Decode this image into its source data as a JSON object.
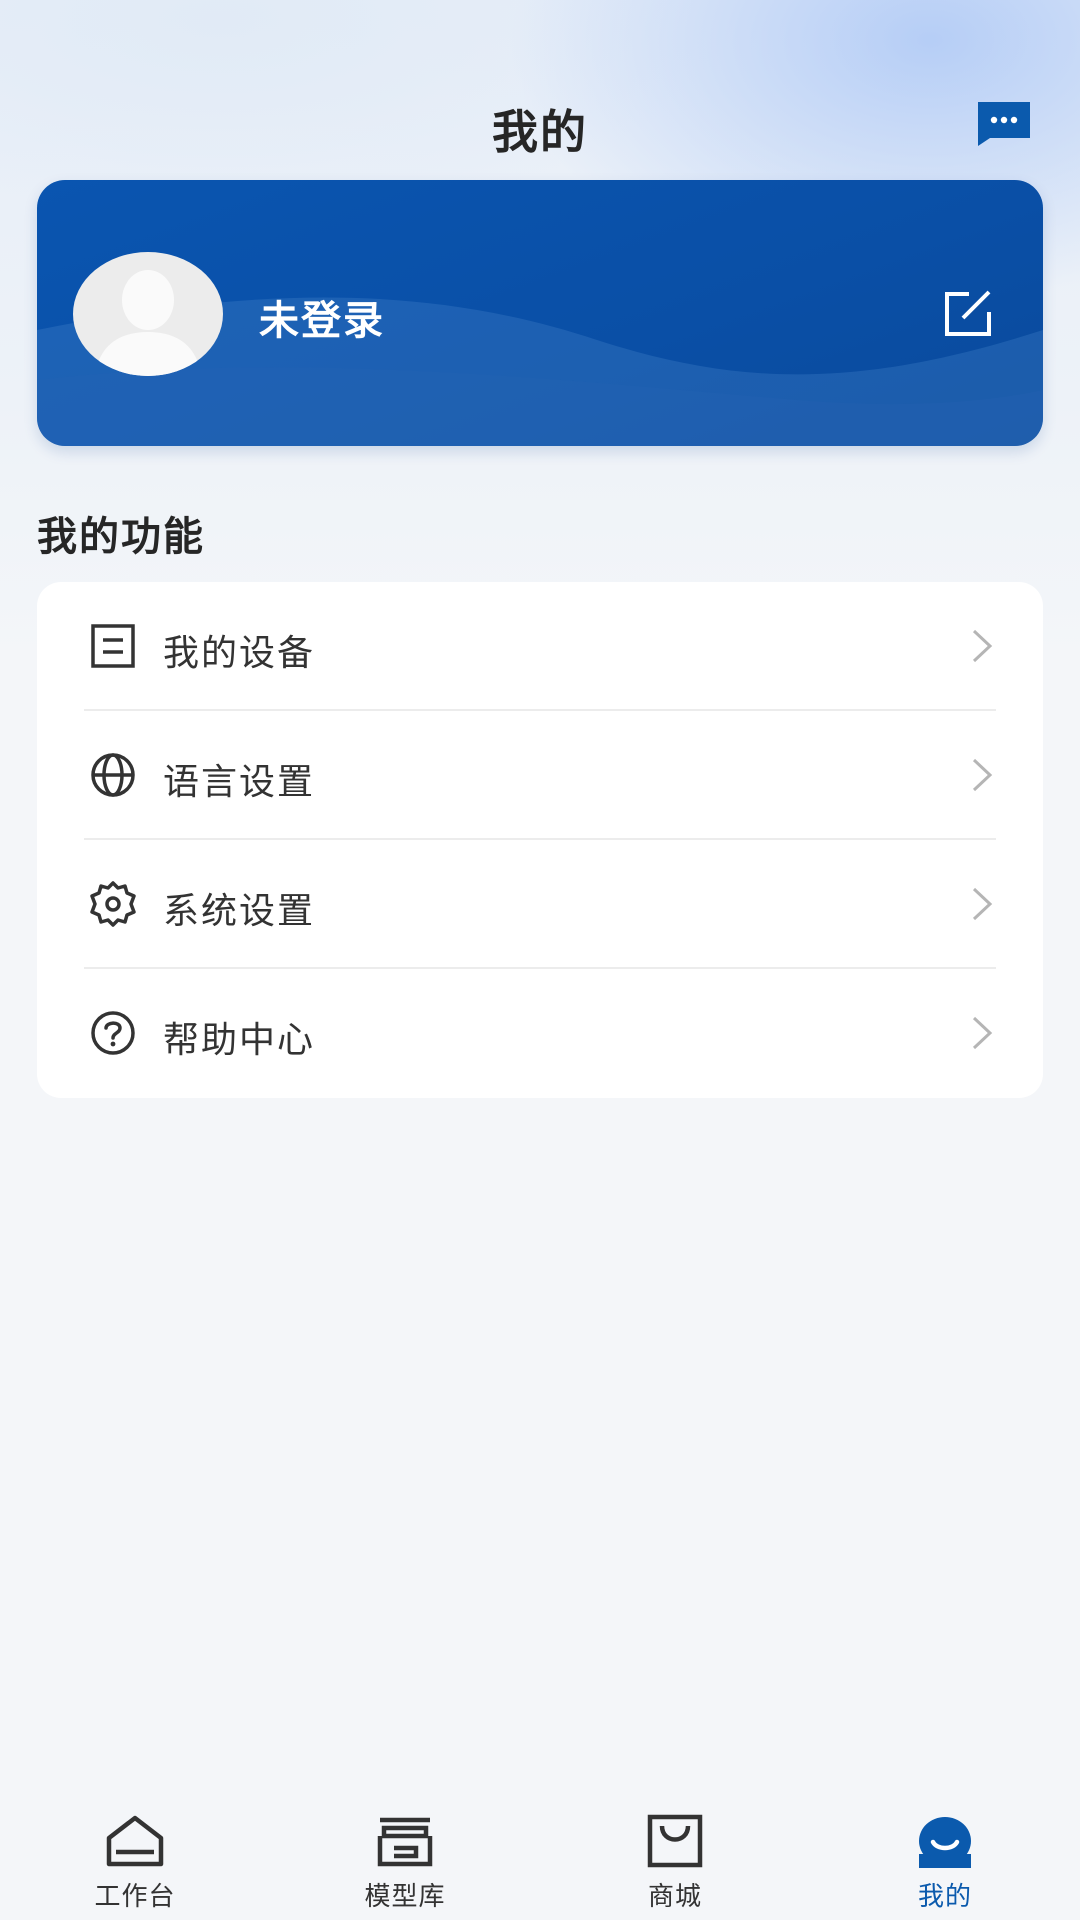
{
  "header": {
    "title": "我的",
    "message_icon": "chat-bubble-icon"
  },
  "profile": {
    "name": "未登录",
    "avatar_icon": "default-avatar-icon",
    "edit_icon": "edit-icon"
  },
  "functions": {
    "title": "我的功能",
    "items": [
      {
        "label": "我的设备",
        "icon": "device-icon"
      },
      {
        "label": "语言设置",
        "icon": "globe-icon"
      },
      {
        "label": "系统设置",
        "icon": "gear-icon"
      },
      {
        "label": "帮助中心",
        "icon": "help-icon"
      }
    ]
  },
  "tabbar": {
    "items": [
      {
        "label": "工作台",
        "icon": "home-icon"
      },
      {
        "label": "模型库",
        "icon": "archive-icon"
      },
      {
        "label": "商城",
        "icon": "shopping-bag-icon"
      },
      {
        "label": "我的",
        "icon": "profile-icon"
      }
    ],
    "active": "我的",
    "active_color": "#0b5aad"
  },
  "colors": {
    "brand": "#0a55b0",
    "background": "#f4f6f9",
    "text": "#333333"
  }
}
